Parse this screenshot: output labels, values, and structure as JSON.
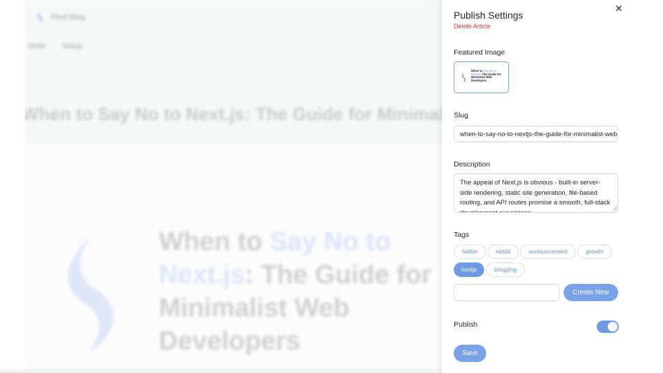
{
  "background": {
    "brand_name": "Pixel Blog",
    "nav_items": [
      "Write",
      "Setup"
    ],
    "article_title": "When to Say No to Next.js: The Guide for Minimalist Web Developers",
    "cover_text_1": "When to ",
    "cover_text_hl": "Say No to Next.js",
    "cover_text_2": ": The Guide for Minimalist Web Developers"
  },
  "panel": {
    "title": "Publish Settings",
    "delete_label": "Delete Article",
    "close_icon": "close-icon",
    "featured_image_label": "Featured Image",
    "thumbnail": {
      "text_1": "When to ",
      "text_hl": "Say No to Next.js",
      "text_2": ": The Guide for Minimalist Web Developers"
    },
    "slug_label": "Slug",
    "slug_value": "when-to-say-no-to-nextjs-the-guide-for-minimalist-web-developers",
    "description_label": "Description",
    "description_value": "The appeal of Next.js is obvious - built-in server-side rendering, static site generation, file-based routing, and API routes promise a smooth, full-stack development experience.",
    "tags_label": "Tags",
    "tags": [
      {
        "label": "twitter",
        "active": false
      },
      {
        "label": "reddit",
        "active": false
      },
      {
        "label": "announcement",
        "active": false
      },
      {
        "label": "growth",
        "active": false
      },
      {
        "label": "nextjs",
        "active": true
      },
      {
        "label": "blogging",
        "active": false
      }
    ],
    "new_tag_value": "",
    "create_new_label": "Create New",
    "publish_label": "Publish",
    "publish_enabled": true,
    "save_label": "Save"
  },
  "colors": {
    "accent": "#6f9ae6",
    "danger": "#e53935"
  }
}
